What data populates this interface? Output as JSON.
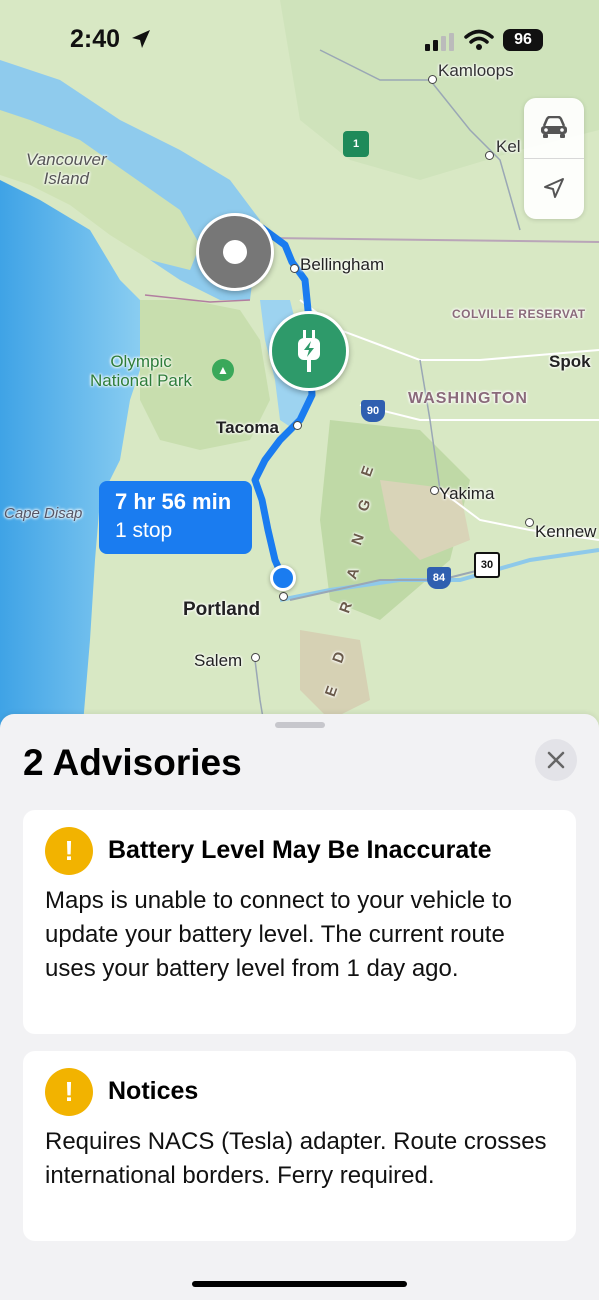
{
  "status_bar": {
    "time": "2:40",
    "battery": "96"
  },
  "map": {
    "labels": {
      "kamloops": "Kamloops",
      "kelowna": "Kel",
      "vancouver_island_1": "Vancouver",
      "vancouver_island_2": "Island",
      "bellingham": "Bellingham",
      "colville": "COLVILLE RESERVAT",
      "olympic_1": "Olympic",
      "olympic_2": "National Park",
      "spokane": "Spok",
      "washington": "WASHINGTON",
      "tacoma": "Tacoma",
      "cape": "Cape Disap",
      "yakima": "Yakima",
      "kennewick": "Kennew",
      "portland": "Portland",
      "salem": "Salem",
      "range_letters": [
        "E",
        "G",
        "N",
        "A",
        "R",
        "D",
        "E"
      ],
      "shield_90": "90",
      "shield_84": "84",
      "shield_30": "30",
      "canada_shield": "1"
    },
    "route_bubble": {
      "duration": "7 hr 56 min",
      "stops": "1 stop"
    },
    "colors": {
      "route": "#1a7cf0",
      "charger": "#2e9a6a",
      "warning": "#f2b300"
    }
  },
  "sheet": {
    "title": "2 Advisories",
    "cards": [
      {
        "title": "Battery Level May Be Inaccurate",
        "body": "Maps is unable to connect to your vehicle to update your battery level. The current route uses your battery level from 1 day ago.",
        "icon": "exclamation-icon"
      },
      {
        "title": "Notices",
        "body": "Requires NACS (Tesla) adapter. Route crosses international borders. Ferry required.",
        "icon": "exclamation-icon"
      }
    ]
  }
}
